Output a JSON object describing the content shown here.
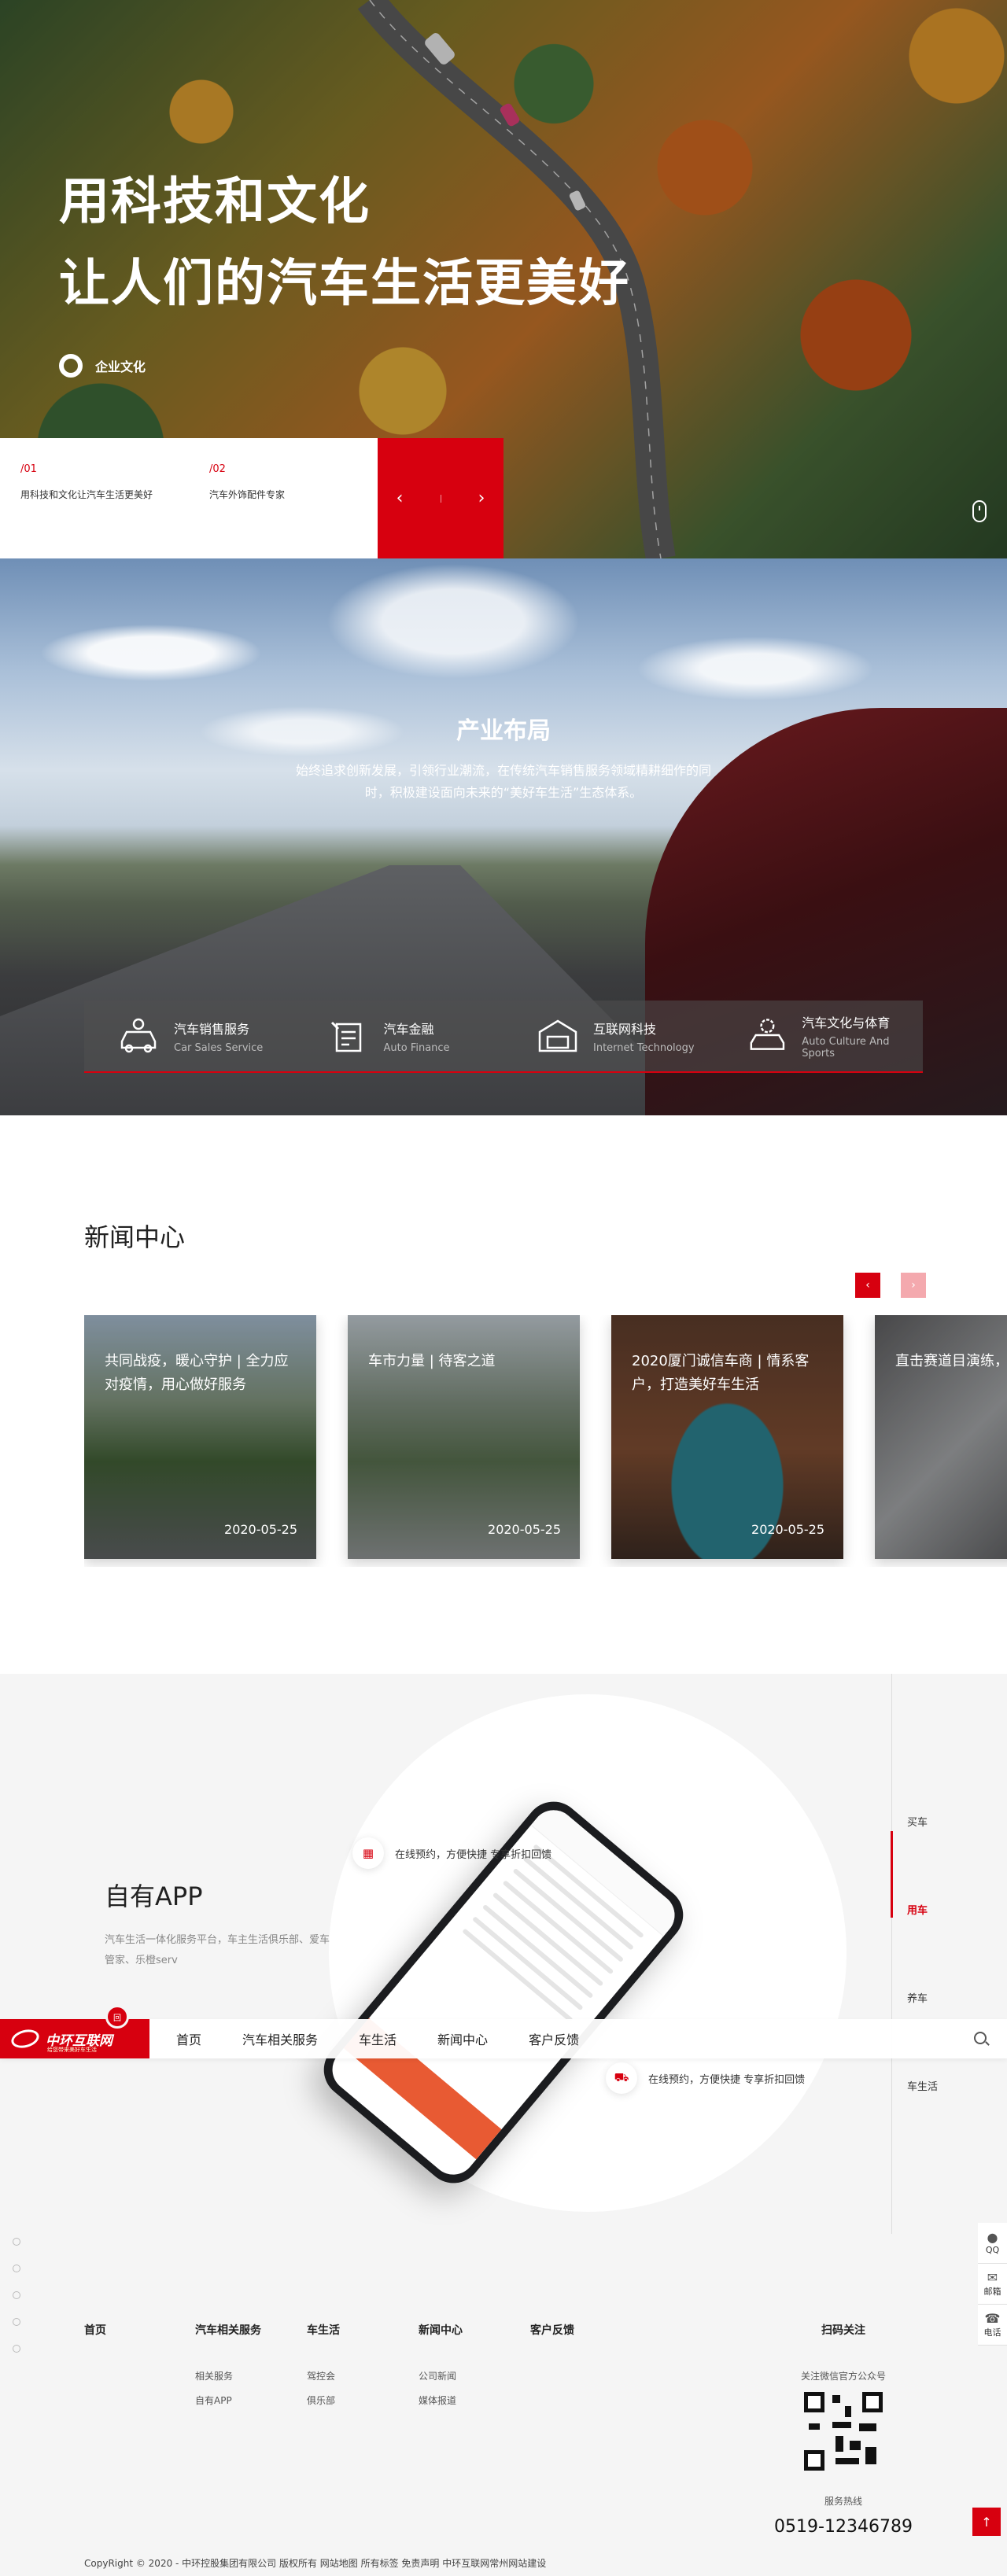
{
  "hero": {
    "title_line1": "用科技和文化",
    "title_line2": "让人们的汽车生活更美好",
    "link_label": "企业文化",
    "slides": [
      {
        "num": "/01",
        "label": "用科技和文化让汽车生活更美好"
      },
      {
        "num": "/02",
        "label": "汽车外饰配件专家"
      }
    ],
    "prev_icon": "‹",
    "next_icon": "›"
  },
  "industry": {
    "title": "产业布局",
    "desc": "始终追求创新发展，引领行业潮流，在传统汽车销售服务领域精耕细作的同时，积极建设面向未来的“美好车生活”生态体系。",
    "items": [
      {
        "cn": "汽车销售服务",
        "en": "Car Sales Service",
        "icon": "car-service-icon"
      },
      {
        "cn": "汽车金融",
        "en": "Auto Finance",
        "icon": "finance-icon"
      },
      {
        "cn": "互联网科技",
        "en": "Internet Technology",
        "icon": "garage-icon"
      },
      {
        "cn": "汽车文化与体育",
        "en": "Auto Culture And Sports",
        "icon": "car-gear-icon"
      }
    ]
  },
  "news": {
    "title": "新闻中心",
    "prev_icon": "‹",
    "next_icon": "›",
    "items": [
      {
        "caption": "共同战疫，暖心守护 | 全力应对疫情，用心做好服务",
        "date": "2020-05-25"
      },
      {
        "caption": "车市力量 | 待客之道",
        "date": "2020-05-25"
      },
      {
        "caption": "2020厦门诚信车商 | 情系客户，打造美好车生活",
        "date": "2020-05-25"
      },
      {
        "caption": "直击赛道目演练，遵服务团队",
        "date": ""
      }
    ]
  },
  "app": {
    "title": "自有APP",
    "desc": "汽车生活一体化服务平台，车主生活俱乐部、爱车管家、乐橙serv",
    "features": [
      {
        "label": "在线预约，方便快捷 专享折扣回馈",
        "icon": "calendar-icon"
      },
      {
        "label": "在线预约，方便快捷 专享折扣回馈",
        "icon": "car-icon"
      }
    ],
    "side": [
      "买车",
      "用车",
      "养车",
      "车生活"
    ],
    "side_active": "用车"
  },
  "nav": {
    "logo": "中环互联网",
    "logo_sub": "给您带来美好车生活",
    "badge": "回",
    "items": [
      "首页",
      "汽车相关服务",
      "车生活",
      "新闻中心",
      "客户反馈"
    ]
  },
  "footer": {
    "cols": [
      {
        "head": "首页",
        "links": []
      },
      {
        "head": "汽车相关服务",
        "links": [
          "相关服务",
          "自有APP"
        ]
      },
      {
        "head": "车生活",
        "links": [
          "驾控会",
          "俱乐部"
        ]
      },
      {
        "head": "新闻中心",
        "links": [
          "公司新闻",
          "媒体报道"
        ]
      },
      {
        "head": "客户反馈",
        "links": []
      }
    ],
    "qr_head": "扫码关注",
    "qr_text": "关注微信官方公众号",
    "hotline_label": "服务热线",
    "hotline": "0519-12346789",
    "copyright": "CopyRight © 2020 - 中环控股集团有限公司 版权所有    网站地图 所有标签 免责声明 中环互联网常州网站建设",
    "side_tools": [
      {
        "label": "QQ",
        "icon": "qq-icon"
      },
      {
        "label": "邮箱",
        "icon": "mail-icon"
      },
      {
        "label": "电话",
        "icon": "phone-icon"
      }
    ],
    "top_icon": "↑"
  },
  "colors": {
    "brand": "#d7000f",
    "brand_light": "#f4a9ae",
    "bg_light": "#f5f5f5"
  }
}
